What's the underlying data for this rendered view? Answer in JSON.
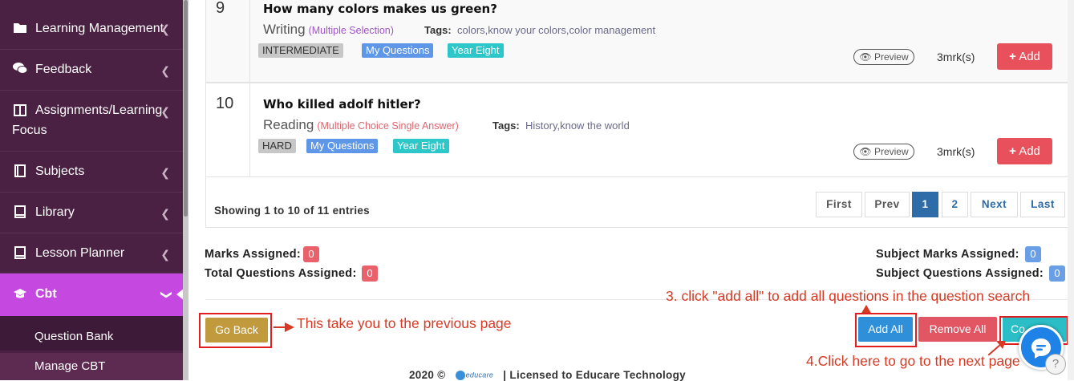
{
  "sidebar": {
    "items": [
      {
        "label": "Learning Management",
        "icon": "folder-icon"
      },
      {
        "label": "Feedback",
        "icon": "comments-icon"
      },
      {
        "label": "Assignments/Learning",
        "label2": "Focus",
        "icon": "book-icon"
      },
      {
        "label": "Subjects",
        "icon": "book-icon"
      },
      {
        "label": "Library",
        "icon": "book-icon"
      },
      {
        "label": "Lesson Planner",
        "icon": "book-icon"
      },
      {
        "label": "Cbt",
        "icon": "graduation-cap-icon"
      }
    ],
    "subitems": [
      "Question Bank",
      "Manage CBT"
    ],
    "active_color": "#c548e0",
    "bg_color": "#4a2142"
  },
  "questions": [
    {
      "number": "9",
      "title": "How many colors makes us green?",
      "type": "Writing",
      "subtype": "(Multiple Selection)",
      "subtype_color": "#a055c8",
      "tags_label": "Tags:",
      "tags": "colors,know your colors,color management",
      "level": "INTERMEDIATE",
      "source": "My Questions",
      "year": "Year Eight",
      "preview": "Preview",
      "marks": "3mrk(s)",
      "add": "Add"
    },
    {
      "number": "10",
      "title": "Who killed adolf hitler?",
      "type": "Reading",
      "subtype": "(Multiple Choice Single Answer)",
      "subtype_color": "#e0646e",
      "tags_label": "Tags:",
      "tags": "History,know the world",
      "level": "HARD",
      "source": "My Questions",
      "year": "Year Eight",
      "preview": "Preview",
      "marks": "3mrk(s)",
      "add": "Add"
    }
  ],
  "table_footer": {
    "showing": "Showing 1 to 10 of 11 entries",
    "pagination": [
      "First",
      "Prev",
      "1",
      "2",
      "Next",
      "Last"
    ],
    "active_page": "1"
  },
  "summary": {
    "marks_label": "Marks Assigned:",
    "marks_value": "0",
    "total_q_label": "Total Questions Assigned:",
    "total_q_value": "0",
    "subj_marks_label": "Subject Marks Assigned:",
    "subj_marks_value": "0",
    "subj_q_label": "Subject Questions Assigned:",
    "subj_q_value": "0"
  },
  "actions": {
    "go_back": "Go Back",
    "add_all": "Add All",
    "remove_all": "Remove All",
    "continue": "Co"
  },
  "annotations": {
    "go_back": "This take you to the previous page",
    "add_all": "3. click \"add all\" to add all questions in the question search",
    "continue": "4.Click here to go to the next page"
  },
  "footer": {
    "year": "2020 ©",
    "logo": "educare",
    "license": "|  Licensed to Educare Technology"
  }
}
